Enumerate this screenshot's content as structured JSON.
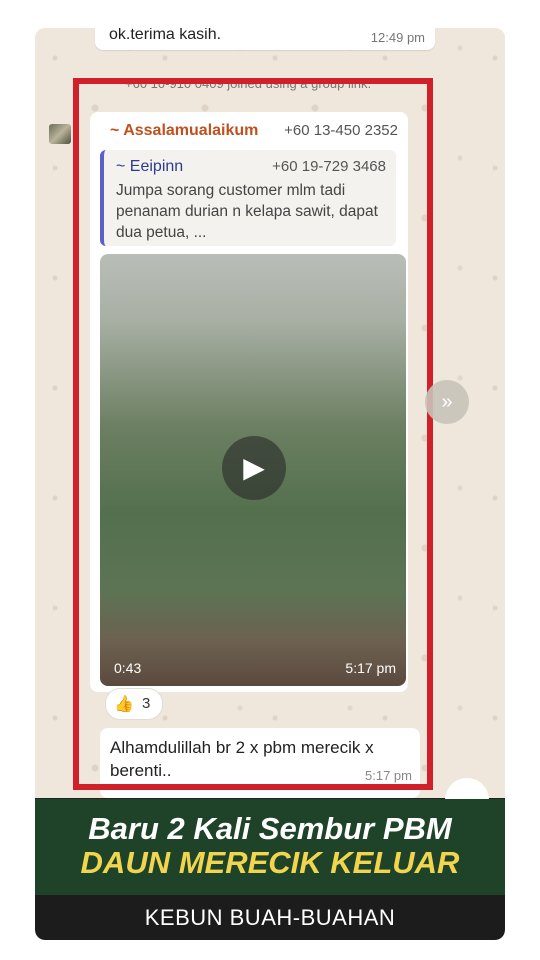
{
  "chat": {
    "prev_message": {
      "text": "ok.terima kasih.",
      "time": "12:49 pm"
    },
    "system_notice": "+60 10-910 0409 joined using a group link.",
    "message": {
      "sender_name": "~ Assalamualaikum",
      "sender_phone": "+60 13-450 2352",
      "quote": {
        "name": "~ Eeipinn",
        "phone": "+60 19-729 3468",
        "text": "Jumpa sorang customer mlm tadi penanam durian n kelapa sawit, dapat dua petua, ..."
      },
      "video": {
        "duration": "0:43",
        "time": "5:17 pm",
        "play_icon": "▶"
      },
      "reaction": {
        "emoji": "👍",
        "count": "3"
      }
    },
    "reply": {
      "text": "Alhamdulillah br 2 x pbm merecik x berenti..",
      "time": "5:17 pm"
    },
    "forward_icon": "»",
    "scroll_down_icon": "⌄"
  },
  "caption": {
    "line1": "Baru 2 Kali Sembur PBM",
    "line2": "DAUN MERECIK KELUAR",
    "footer": "KEBUN BUAH-BUAHAN"
  },
  "colors": {
    "highlight_border": "#d1202a",
    "caption_bg": "#1f4328",
    "caption_accent": "#f2d54f",
    "footer_bg": "#1c1c1c"
  }
}
